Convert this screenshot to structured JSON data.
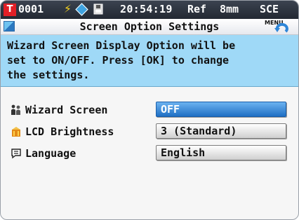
{
  "status_bar": {
    "mark": "T",
    "number": "0001",
    "time": "20:54:19",
    "ref": "Ref",
    "aperture": "8mm",
    "mode": "SCE"
  },
  "title_bar": {
    "title": "Screen Option Settings",
    "menu_label": "MENU"
  },
  "help_text": "Wizard Screen Display Option will be\nset to ON/OFF. Press [OK] to change\nthe settings.",
  "settings": [
    {
      "label": "Wizard Screen",
      "value": "OFF",
      "icon": "wizard-icon",
      "selected": true
    },
    {
      "label": "LCD Brightness",
      "value": "3 (Standard)",
      "icon": "brightness-icon",
      "selected": false
    },
    {
      "label": "Language",
      "value": "English",
      "icon": "speech-bubble-icon",
      "selected": false
    }
  ],
  "colors": {
    "help_bg": "#9fd9f7",
    "selected": "#1f6fc4",
    "status_mark": "#e21f26"
  }
}
